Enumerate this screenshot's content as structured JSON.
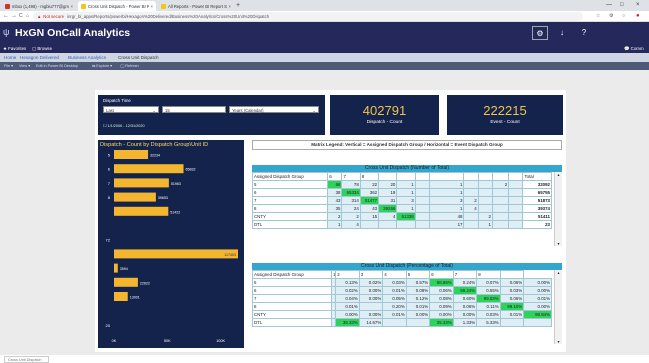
{
  "browser": {
    "tabs": [
      {
        "label": "Inbox (1,496) - mgbiu777@gmai",
        "close": "×",
        "active": false,
        "color": "#d93025"
      },
      {
        "label": "Cross Unit Dispatch - Power BI R",
        "close": "×",
        "active": true,
        "color": "#f2c811"
      },
      {
        "label": "All Reports - Power BI Report Se",
        "close": "×",
        "active": false,
        "color": "#f2c811"
      }
    ],
    "new_tab": "+",
    "window_controls": [
      "—",
      "□",
      "×"
    ],
    "nav": {
      "back": "←",
      "forward": "→",
      "reload": "C",
      "home": "⌂"
    },
    "url_warning": "▲",
    "not_secure": "Not secure",
    "url": "inrgr_bi_apps/Reports/powerbi/Hexagon%20Delivered/Business%20Analytics/Cross%20Unit%20Dispatch",
    "right_icons": [
      "☆",
      "⚙",
      "○",
      "●"
    ]
  },
  "app": {
    "logo": "ψ",
    "title": "HxGN OnCall Analytics",
    "icons": [
      "⚙",
      "↓",
      "?"
    ]
  },
  "favorites_bar": {
    "favorites": "★ Favorites",
    "browse": "▢ Browse",
    "comments": "💬 Comm"
  },
  "breadcrumb": [
    {
      "label": "Home",
      "link": true
    },
    {
      "label": "Hexagon Delivered",
      "link": true
    },
    {
      "label": "Business Analytics",
      "link": true
    },
    {
      "label": "Cross Unit Dispatch",
      "link": false
    }
  ],
  "toolbar": {
    "file": "File ▾",
    "view": "View ▾",
    "edit": "Edit in Power BI Desktop",
    "explore": "⇆ Explore ▾",
    "refresh": "◯ Refresh"
  },
  "slicer": {
    "label": "Dispatch Time",
    "mode": "Last",
    "value": "15",
    "unit": "Years (Calendar)",
    "caret": "⌄",
    "dates": "☐ 1/1/2006 - 12/31/2020"
  },
  "cards": [
    {
      "value": "402791",
      "caption": "Dispatch - Count"
    },
    {
      "value": "222215",
      "caption": "Event - Count"
    }
  ],
  "legend_text": "Matrix Legend:    Vertical = Assigned Dispatch Group   /   Horizontal = Event Dispatch Group",
  "chart_data": {
    "type": "bar",
    "title": "Dispatch - Count by Dispatch Group\\Unit ID",
    "categories": [
      "5",
      "6",
      "7",
      "8",
      "",
      "",
      "72",
      "",
      "",
      "",
      "",
      "",
      "20"
    ],
    "values": [
      32234,
      65832,
      51963,
      39653,
      51422,
      0,
      0,
      117403,
      3594,
      22622,
      13001,
      0,
      0
    ],
    "value_labels": [
      "32234",
      "65832",
      "51963",
      "39653",
      "51422",
      "",
      "",
      "117403",
      "3594",
      "22622",
      "13001",
      "",
      ""
    ],
    "xlim": [
      0,
      117403
    ],
    "xticks": [
      "0K",
      "50K",
      "100K"
    ],
    "bar_color": "#f4b52f"
  },
  "matrix1": {
    "title": "Cross Unit Dispatch (Number of Total)",
    "header": [
      "Assigned Dispatch Group",
      "6",
      "7",
      "8",
      "",
      "",
      "",
      "",
      "",
      "",
      "",
      "",
      "Total"
    ],
    "rows": [
      [
        "5",
        "68",
        "78",
        "22",
        "20",
        "1",
        "",
        "1",
        "",
        "",
        "2",
        "",
        "32092"
      ],
      [
        "6",
        "38",
        "65334",
        "362",
        "19",
        "1",
        "",
        "1",
        "",
        "",
        "",
        "",
        "65755"
      ],
      [
        "7",
        "43",
        "314",
        "51477",
        "31",
        "3",
        "",
        "3",
        "2",
        "",
        "",
        "",
        "51873"
      ],
      [
        "8",
        "35",
        "24",
        "43",
        "39266",
        "1",
        "",
        "1",
        "4",
        "",
        "",
        "",
        "39374"
      ],
      [
        "CNTY",
        "2",
        "2",
        "15",
        "4",
        "51338",
        "",
        "48",
        "",
        "2",
        "",
        "",
        "51411"
      ],
      [
        "DTL",
        "1",
        "4",
        "",
        "",
        "",
        "",
        "17",
        "",
        "1",
        "",
        "",
        "23"
      ]
    ],
    "green": [
      [
        0,
        1
      ],
      [
        1,
        2
      ],
      [
        2,
        3
      ],
      [
        3,
        4
      ],
      [
        4,
        5
      ]
    ]
  },
  "matrix2": {
    "title": "Cross Unit Dispatch (Percentage of Total)",
    "header": [
      "Assigned Dispatch Group",
      "1",
      "2",
      "3",
      "4",
      "5",
      "6",
      "7",
      "8",
      ""
    ],
    "rows": [
      [
        "5",
        "",
        "0.13%",
        "0.02%",
        "0.03%",
        "0.57%",
        "98.86%",
        "0.24%",
        "0.07%",
        "0.06%",
        "0.00%"
      ],
      [
        "6",
        "",
        "0.02%",
        "0.00%",
        "0.01%",
        "0.08%",
        "0.06%",
        "99.24%",
        "0.55%",
        "0.03%",
        "0.00%"
      ],
      [
        "7",
        "",
        "0.04%",
        "0.00%",
        "0.05%",
        "0.12%",
        "0.08%",
        "0.60%",
        "99.03%",
        "0.06%",
        "0.01%"
      ],
      [
        "8",
        "",
        "0.01%",
        "",
        "0.20%",
        "0.01%",
        "0.09%",
        "0.06%",
        "0.11%",
        "99.10%",
        "0.00%"
      ],
      [
        "CNTY",
        "",
        "0.00%",
        "0.00%",
        "0.01%",
        "0.00%",
        "0.00%",
        "0.00%",
        "0.03%",
        "0.01%",
        "99.84%"
      ],
      [
        "DTL",
        "",
        "39.33%",
        "14.67%",
        "",
        "",
        "25.33%",
        "1.33%",
        "5.33%",
        "",
        ""
      ]
    ],
    "green": [
      [
        0,
        6
      ],
      [
        1,
        7
      ],
      [
        2,
        8
      ],
      [
        3,
        9
      ],
      [
        4,
        10
      ],
      [
        5,
        2
      ],
      [
        5,
        6
      ]
    ]
  },
  "page_tab": "Cross Unit Dispatch",
  "scroll_up": "▴",
  "scroll_down": "▾"
}
